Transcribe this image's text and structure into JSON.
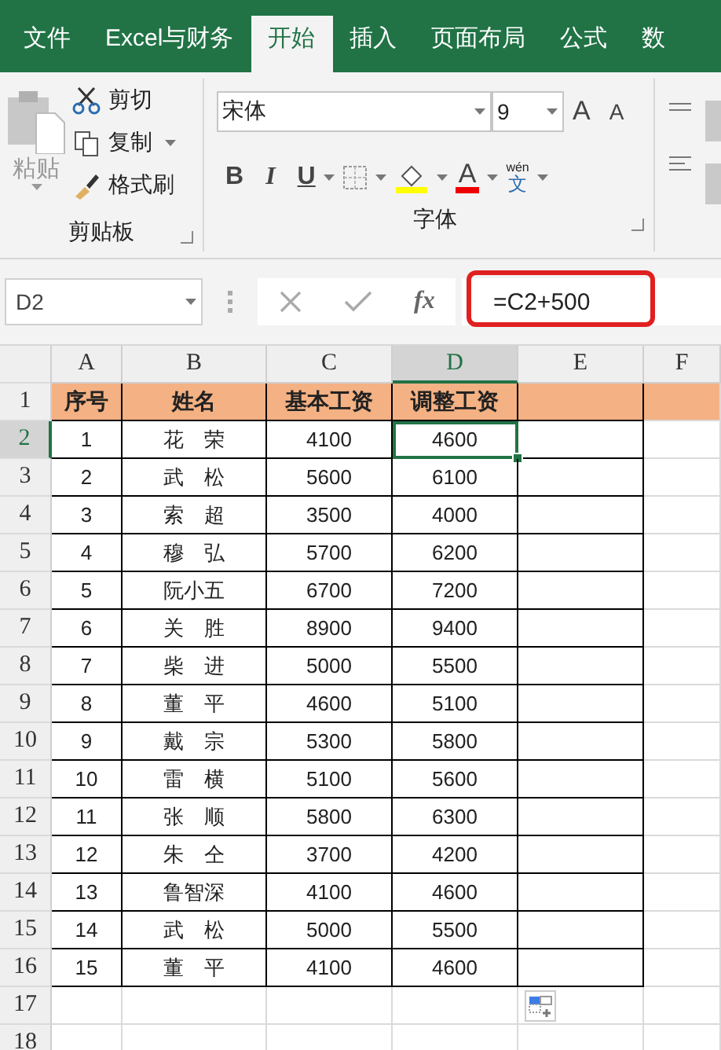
{
  "tabs": [
    {
      "label": "文件",
      "selected": false
    },
    {
      "label": "Excel与财务",
      "selected": false
    },
    {
      "label": "开始",
      "selected": true
    },
    {
      "label": "插入",
      "selected": false
    },
    {
      "label": "页面布局",
      "selected": false
    },
    {
      "label": "公式",
      "selected": false
    },
    {
      "label": "数",
      "selected": false
    }
  ],
  "clipboard": {
    "paste": "粘贴",
    "cut": "剪切",
    "copy": "复制",
    "format_painter": "格式刷",
    "group_label": "剪贴板"
  },
  "font": {
    "family": "宋体",
    "size": "9",
    "grow": "A",
    "shrink": "A",
    "bold": "B",
    "italic": "I",
    "underline": "U",
    "font_color": "A",
    "phonetic_top": "wén",
    "phonetic_bottom": "文",
    "group_label": "字体"
  },
  "formula_bar": {
    "name_box": "D2",
    "fx": "fx",
    "formula": "=C2+500",
    "highlighted": true
  },
  "columns": [
    {
      "label": "A",
      "selected": false
    },
    {
      "label": "B",
      "selected": false
    },
    {
      "label": "C",
      "selected": false
    },
    {
      "label": "D",
      "selected": true
    },
    {
      "label": "E",
      "selected": false
    },
    {
      "label": "F",
      "selected": false
    }
  ],
  "rows": [
    {
      "number": "1",
      "kind": "header",
      "selected": false,
      "cells": [
        "序号",
        "姓名",
        "基本工资",
        "调整工资",
        ""
      ]
    },
    {
      "number": "2",
      "kind": "data",
      "selected": true,
      "cells": [
        "1",
        "花　荣",
        "4100",
        "4600",
        ""
      ]
    },
    {
      "number": "3",
      "kind": "data",
      "selected": false,
      "cells": [
        "2",
        "武　松",
        "5600",
        "6100",
        ""
      ]
    },
    {
      "number": "4",
      "kind": "data",
      "selected": false,
      "cells": [
        "3",
        "索　超",
        "3500",
        "4000",
        ""
      ]
    },
    {
      "number": "5",
      "kind": "data",
      "selected": false,
      "cells": [
        "4",
        "穆　弘",
        "5700",
        "6200",
        ""
      ]
    },
    {
      "number": "6",
      "kind": "data",
      "selected": false,
      "cells": [
        "5",
        "阮小五",
        "6700",
        "7200",
        ""
      ]
    },
    {
      "number": "7",
      "kind": "data",
      "selected": false,
      "cells": [
        "6",
        "关　胜",
        "8900",
        "9400",
        ""
      ]
    },
    {
      "number": "8",
      "kind": "data",
      "selected": false,
      "cells": [
        "7",
        "柴　进",
        "5000",
        "5500",
        ""
      ]
    },
    {
      "number": "9",
      "kind": "data",
      "selected": false,
      "cells": [
        "8",
        "董　平",
        "4600",
        "5100",
        ""
      ]
    },
    {
      "number": "10",
      "kind": "data",
      "selected": false,
      "cells": [
        "9",
        "戴　宗",
        "5300",
        "5800",
        ""
      ]
    },
    {
      "number": "11",
      "kind": "data",
      "selected": false,
      "cells": [
        "10",
        "雷　横",
        "5100",
        "5600",
        ""
      ]
    },
    {
      "number": "12",
      "kind": "data",
      "selected": false,
      "cells": [
        "11",
        "张　顺",
        "5800",
        "6300",
        ""
      ]
    },
    {
      "number": "13",
      "kind": "data",
      "selected": false,
      "cells": [
        "12",
        "朱　仝",
        "3700",
        "4200",
        ""
      ]
    },
    {
      "number": "14",
      "kind": "data",
      "selected": false,
      "cells": [
        "13",
        "鲁智深",
        "4100",
        "4600",
        ""
      ]
    },
    {
      "number": "15",
      "kind": "data",
      "selected": false,
      "cells": [
        "14",
        "武　松",
        "5000",
        "5500",
        ""
      ]
    },
    {
      "number": "16",
      "kind": "data",
      "selected": false,
      "cells": [
        "15",
        "董　平",
        "4100",
        "4600",
        ""
      ]
    },
    {
      "number": "17",
      "kind": "empty",
      "selected": false,
      "cells": []
    },
    {
      "number": "18",
      "kind": "empty",
      "selected": false,
      "cells": []
    }
  ]
}
